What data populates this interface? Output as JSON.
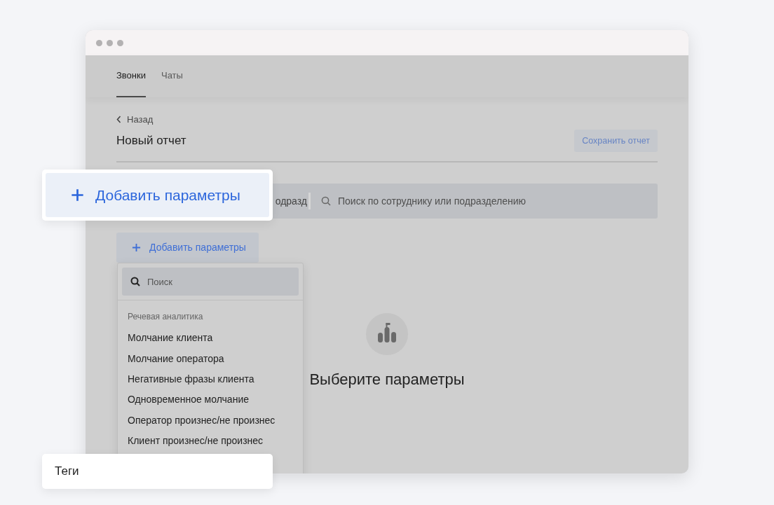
{
  "window": {
    "tabs": [
      {
        "label": "Звонки",
        "selected": true
      },
      {
        "label": "Чаты",
        "selected": false
      }
    ],
    "back_link": "Назад",
    "title": "Новый отчет",
    "save_button": "Сохранить отчет",
    "filter_bar": {
      "field_text": "одразд",
      "search_placeholder": "Поиск по сотруднику или подразделению"
    },
    "add_button": "Добавить параметры",
    "dropdown": {
      "search_placeholder": "Поиск",
      "group": "Речевая аналитика",
      "items": [
        "Молчание клиента",
        "Молчание оператора",
        "Негативные фразы клиента",
        "Одновременное молчание",
        "Оператор произнес/не произнес",
        "Клиент произнес/не произнес"
      ]
    },
    "empty_state": {
      "title": "Выберите параметры"
    }
  },
  "callouts": [
    {
      "kind": "button",
      "label": "Добавить параметры"
    },
    {
      "kind": "item",
      "label": "Теги"
    }
  ]
}
